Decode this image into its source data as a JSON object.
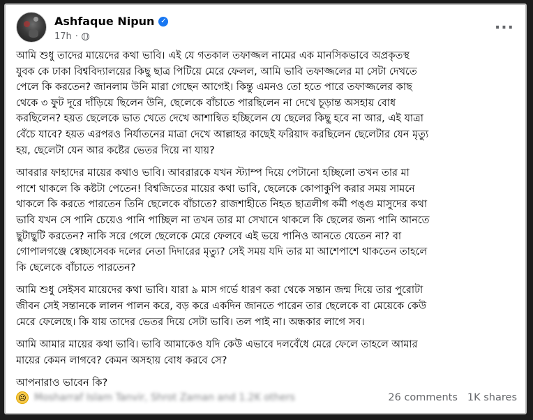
{
  "post": {
    "author": "Ashfaque Nipun",
    "timestamp": "17h",
    "menu_label": "...",
    "paragraphs": [
      "আমি শুধু তাদের মায়েদের কথা ভাবি। এই যে গতকাল তফাজ্জল নামের এক মানসিকভাবে অপ্রকৃতস্থ\nযুবক কে ঢাকা বিশ্ববিদ্যালয়ের কিছু ছাত্র পিটিয়ে মেরে ফেলল, আমি ভাবি তফাজ্জলের মা সেটা দেখতে\nপেলে কি করতেন? জানলাম উনি মারা গেছেন আগেই। কিন্তু এমনও তো হতে পারে তফাজ্জলের কাছ\nথেকে ৩ ফুট দূরে দাঁড়িয়ে ছিলেন উনি, ছেলেকে বাঁচাতে পারছিলেন না দেখে চূড়ান্ত অসহায় বোধ\nকরছিলেন? হয়ত ছেলেকে ভাত খেতে দেখে আশান্বিত হচ্ছিলেন যে ছেলের কিছু হবে না আর, এই যাত্রা\nবেঁচে যাবে? হয়ত এরপরও নির্যাতনের মাত্রা দেখে আল্লাহর কাছেই ফরিয়াদ করছিলেন ছেলেটার যেন মৃত্যু\nহয়, ছেলেটা যেন আর কষ্টের ভেতর দিয়ে না যায়?",
      "আবরার ফাহাদের মায়ের কথাও ভাবি। আবরারকে যখন স্ট্যাম্প দিয়ে পেটানো হচ্ছিলো তখন তার মা\nপাশে থাকলে কি কষ্টটা পেতেন! বিশ্বজিতের মায়ের কথা ভাবি, ছেলেকে কোপাকুপি করার সময় সামনে\nথাকলে কি করতে পারতেন তিনি ছেলেকে বাঁচাতে? রাজশাহীতে নিহত ছাত্রলীগ কর্মী পঙ্গু মাসুদের কথা\nভাবি যখন সে পানি চেয়েও পানি পাচ্ছিল না তখন তার মা সেখানে থাকলে কি ছেলের জন্য পানি আনতে\nছুটাছুটি করতেন? নাকি সরে গেলে ছেলেকে মেরে ফেলবে এই ভয়ে পানিও আনতে যেতেন না? বা\nগোপালগঞ্জে স্বেচ্ছাসেবক দলের নেতা দিদারের মৃত্যু? সেই সময় যদি তার মা আশেপাশে থাকতেন তাহলে\nকি ছেলেকে বাঁচাতে পারতেন?",
      "আমি শুধু সেইসব মায়েদের কথা ভাবি। যারা ৯ মাস গর্ভে ধারণ করা থেকে সন্তান জন্ম দিয়ে তার পুরোটা\nজীবন সেই সন্তানকে লালন পালন করে, বড় করে একদিন জানতে পারেন তার ছেলেকে বা মেয়েকে কেউ\nমেরে ফেলেছে। কি যায় তাদের ভেতর দিয়ে সেটা ভাবি। তল পাই না। অন্ধকার লাগে সব।",
      "আমি আমার মায়ের কথা ভাবি। ভাবি আমাকেও যদি কেউ এভাবে দলবেঁধে মেরে ফেলে তাহলে আমার\nমায়ের কেমন লাগবে? কেমন অসহায় বোধ করবে সে?",
      "আপনারাও ভাবেন কি?"
    ]
  },
  "footer": {
    "reactors_text": "Mosharraf Islam Tanvir, Shrot Zaman and 1.2K others",
    "comments": "26 comments",
    "shares": "1K shares",
    "reaction_icon": "sad-emoji-icon"
  },
  "colors": {
    "text": "#050505",
    "muted": "#65676b",
    "verified": "#1877f2",
    "background": "#1c1c1c"
  }
}
